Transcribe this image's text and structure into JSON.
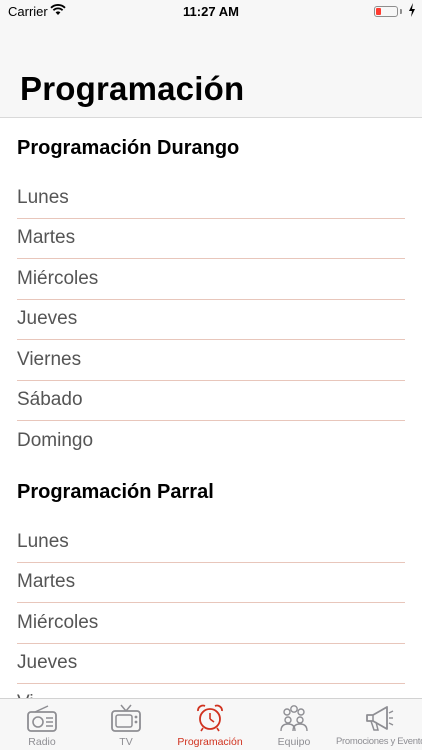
{
  "status_bar": {
    "carrier": "Carrier",
    "time": "11:27 AM",
    "battery_color": "#ff3b30"
  },
  "page": {
    "title": "Programación"
  },
  "sections": [
    {
      "title": "Programación Durango",
      "items": [
        "Lunes",
        "Martes",
        "Miércoles",
        "Jueves",
        "Viernes",
        "Sábado",
        "Domingo"
      ]
    },
    {
      "title": "Programación Parral",
      "items": [
        "Lunes",
        "Martes",
        "Miércoles",
        "Jueves",
        "Vi"
      ]
    }
  ],
  "tab_bar": {
    "active_color": "#d0321f",
    "inactive_color": "#8e8e93",
    "tabs": [
      {
        "label": "Radio",
        "icon": "radio-icon"
      },
      {
        "label": "TV",
        "icon": "tv-icon"
      },
      {
        "label": "Programación",
        "icon": "alarm-clock-icon"
      },
      {
        "label": "Equipo",
        "icon": "team-icon"
      },
      {
        "label": "Promociones y Eventos",
        "icon": "megaphone-icon"
      }
    ]
  }
}
